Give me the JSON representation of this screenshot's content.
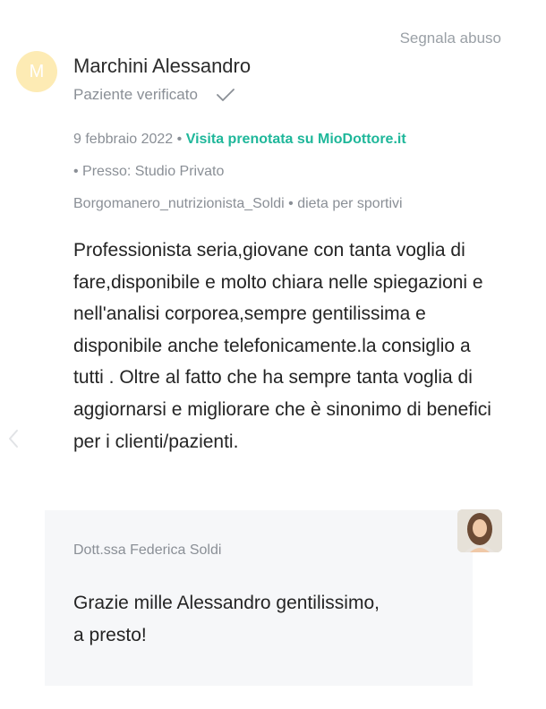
{
  "report_link": "Segnala abuso",
  "reviewer": {
    "initial": "M",
    "name": "Marchini Alessandro",
    "status": "Paziente verificato"
  },
  "meta": {
    "date": "9 febbraio 2022",
    "separator": " • ",
    "booking": "Visita prenotata su MioDottore.it",
    "location": "• Presso: Studio Privato",
    "service_line": "Borgomanero_nutrizionista_Soldi • dieta per sportivi"
  },
  "review_text": "Professionista seria,giovane con tanta voglia di fare,disponibile e molto chiara nelle spiegazioni e nell'analisi corporea,sempre gentilissima e disponibile anche telefonicamente.la consiglio a tutti . Oltre al fatto che ha sempre tanta voglia di aggiornarsi e migliorare che è sinonimo di benefici per i clienti/pazienti.",
  "reply": {
    "author": "Dott.ssa Federica Soldi",
    "text_line1": "Grazie mille Alessandro gentilissimo,",
    "text_line2": "a presto!"
  },
  "icons": {
    "verified": "check-icon",
    "nav_previous": "chevron-left-icon",
    "doctor_photo": "doctor-avatar"
  },
  "colors": {
    "accent": "#1fb79a",
    "avatar_bg": "#fdebb4",
    "muted_text": "#8a8f96",
    "reply_bg": "#f6f7f9"
  }
}
